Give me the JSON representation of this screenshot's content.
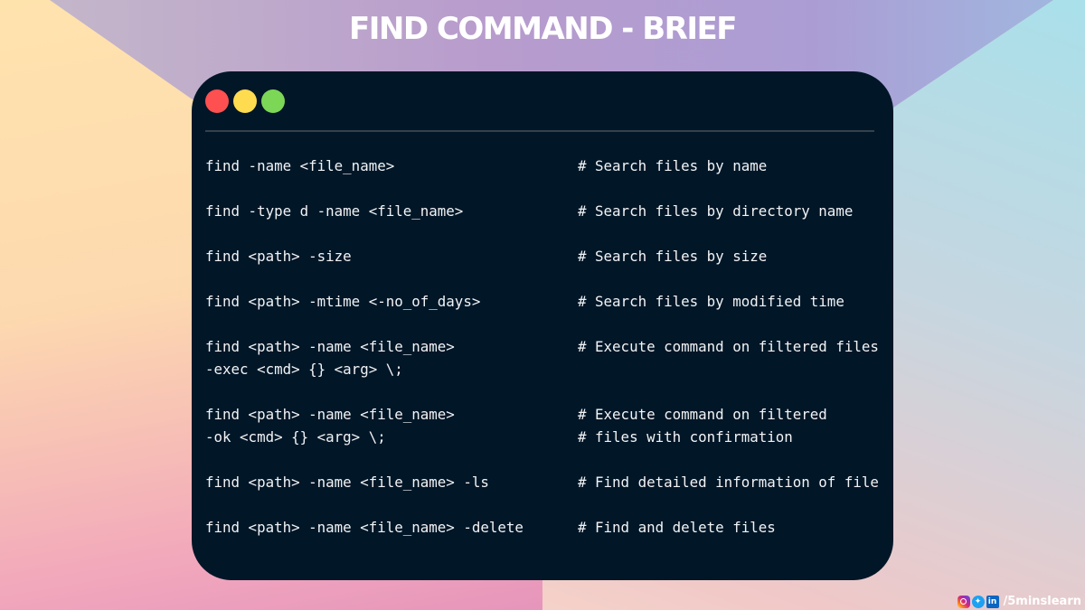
{
  "title": "FIND COMMAND -  BRIEF",
  "terminal": {
    "window_controls": [
      "close",
      "minimize",
      "maximize"
    ],
    "colors": {
      "background": "#011627",
      "close": "#fe5050",
      "minimize": "#fedb4f",
      "maximize": "#7cd756",
      "text": "#f2f4f6"
    },
    "entries": [
      {
        "lines": [
          {
            "cmd": "find -name <file_name>",
            "comment": "# Search files by name"
          }
        ]
      },
      {
        "lines": [
          {
            "cmd": "find -type d -name <file_name>",
            "comment": "# Search files by directory name"
          }
        ]
      },
      {
        "lines": [
          {
            "cmd": "find <path> -size",
            "comment": "# Search files by size"
          }
        ]
      },
      {
        "lines": [
          {
            "cmd": "find <path> -mtime <-no_of_days>",
            "comment": "# Search files by modified time"
          }
        ]
      },
      {
        "lines": [
          {
            "cmd": "find <path> -name <file_name>",
            "comment": "# Execute command on filtered files"
          },
          {
            "cmd": "-exec <cmd> {} <arg> \\;",
            "comment": ""
          }
        ]
      },
      {
        "lines": [
          {
            "cmd": "find <path> -name <file_name>",
            "comment": "# Execute command on filtered"
          },
          {
            "cmd": "-ok <cmd> {} <arg> \\;",
            "comment": "# files with confirmation"
          }
        ]
      },
      {
        "lines": [
          {
            "cmd": "find <path> -name <file_name> -ls",
            "comment": "# Find detailed information of file"
          }
        ]
      },
      {
        "lines": [
          {
            "cmd": "find <path> -name <file_name> -delete",
            "comment": "# Find and delete files"
          }
        ]
      }
    ]
  },
  "footer": {
    "icons": [
      "instagram-icon",
      "twitter-icon",
      "linkedin-icon"
    ],
    "linkedin_label": "in",
    "handle": "/5minslearn"
  }
}
